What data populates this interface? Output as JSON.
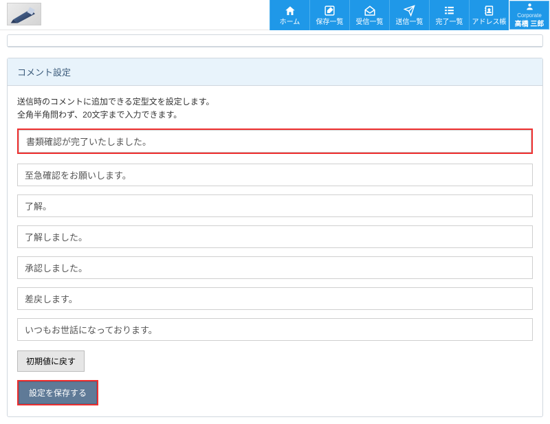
{
  "nav": {
    "home": "ホーム",
    "saved": "保存一覧",
    "inbox": "受信一覧",
    "sent": "送信一覧",
    "done": "完了一覧",
    "address": "アドレス帳",
    "corporate": "Corporate",
    "user_name": "高橋 三郎"
  },
  "section": {
    "title": "コメント設定",
    "desc1": "送信時のコメントに追加できる定型文を設定します。",
    "desc2": "全角半角問わず、20文字まで入力できます。"
  },
  "templates": [
    "書類確認が完了いたしました。",
    "至急確認をお願いします。",
    "了解。",
    "了解しました。",
    "承認しました。",
    "差戻します。",
    "いつもお世話になっております。"
  ],
  "buttons": {
    "reset": "初期値に戻す",
    "save": "設定を保存する"
  }
}
